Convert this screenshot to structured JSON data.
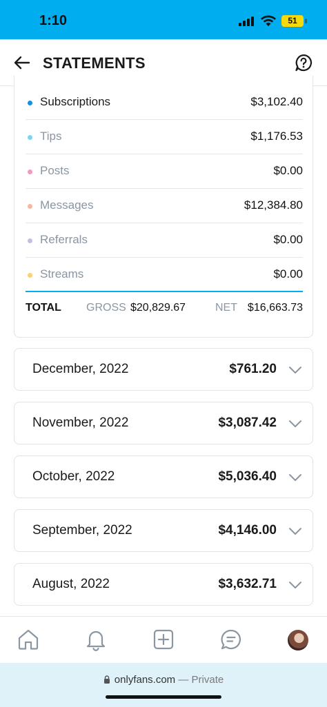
{
  "status_bar": {
    "time": "1:10",
    "battery": "51"
  },
  "header": {
    "title": "STATEMENTS"
  },
  "summary": {
    "categories": [
      {
        "label": "Subscriptions",
        "value": "$3,102.40",
        "color": "#1a8fe0"
      },
      {
        "label": "Tips",
        "value": "$1,176.53",
        "color": "#7dd3f0"
      },
      {
        "label": "Posts",
        "value": "$0.00",
        "color": "#f29abf"
      },
      {
        "label": "Messages",
        "value": "$12,384.80",
        "color": "#f5b9a0"
      },
      {
        "label": "Referrals",
        "value": "$0.00",
        "color": "#c8bde0"
      },
      {
        "label": "Streams",
        "value": "$0.00",
        "color": "#f8d27a"
      }
    ],
    "total_label": "TOTAL",
    "gross_label": "GROSS",
    "gross_value": "$20,829.67",
    "net_label": "NET",
    "net_value": "$16,663.73"
  },
  "months": [
    {
      "label": "December, 2022",
      "amount": "$761.20"
    },
    {
      "label": "November, 2022",
      "amount": "$3,087.42"
    },
    {
      "label": "October, 2022",
      "amount": "$5,036.40"
    },
    {
      "label": "September, 2022",
      "amount": "$4,146.00"
    },
    {
      "label": "August, 2022",
      "amount": "$3,632.71"
    }
  ],
  "bottom_nav": {
    "items": [
      "home-icon",
      "bell-icon",
      "add-post-icon",
      "messages-icon",
      "avatar"
    ]
  },
  "url_bar": {
    "domain": "onlyfans.com",
    "separator": "—",
    "mode": "Private"
  },
  "colors": {
    "accent": "#00aeef",
    "muted_text": "#8a96a3"
  }
}
